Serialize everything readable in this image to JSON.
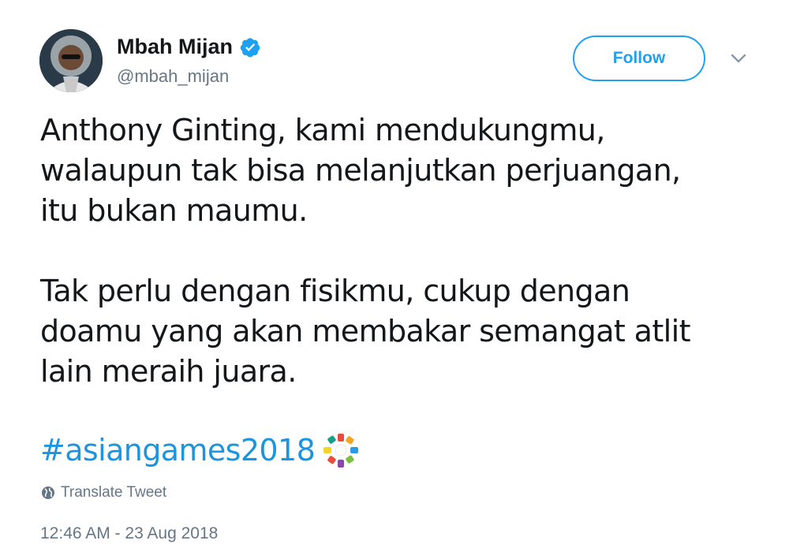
{
  "author": {
    "display_name": "Mbah Mijan",
    "handle": "@mbah_mijan",
    "verified": true
  },
  "follow_button": {
    "label": "Follow"
  },
  "tweet": {
    "text": "Anthony Ginting, kami mendukungmu,\nwalaupun tak bisa melanjutkan perjuangan,\nitu bukan maumu.\n\nTak perlu dengan fisikmu, cukup dengan\ndoamu yang akan membakar semangat atlit\nlain meraih juara.",
    "hashtag": "#asiangames2018",
    "hashtag_emoji": "asian-games-logo-icon"
  },
  "translate": {
    "label": "Translate Tweet",
    "icon": "globe-icon"
  },
  "timestamp": "12:46 AM - 23 Aug 2018",
  "colors": {
    "accent": "#1da1f2",
    "link": "#1b95e0",
    "secondary_text": "#657786",
    "primary_text": "#14171a"
  }
}
